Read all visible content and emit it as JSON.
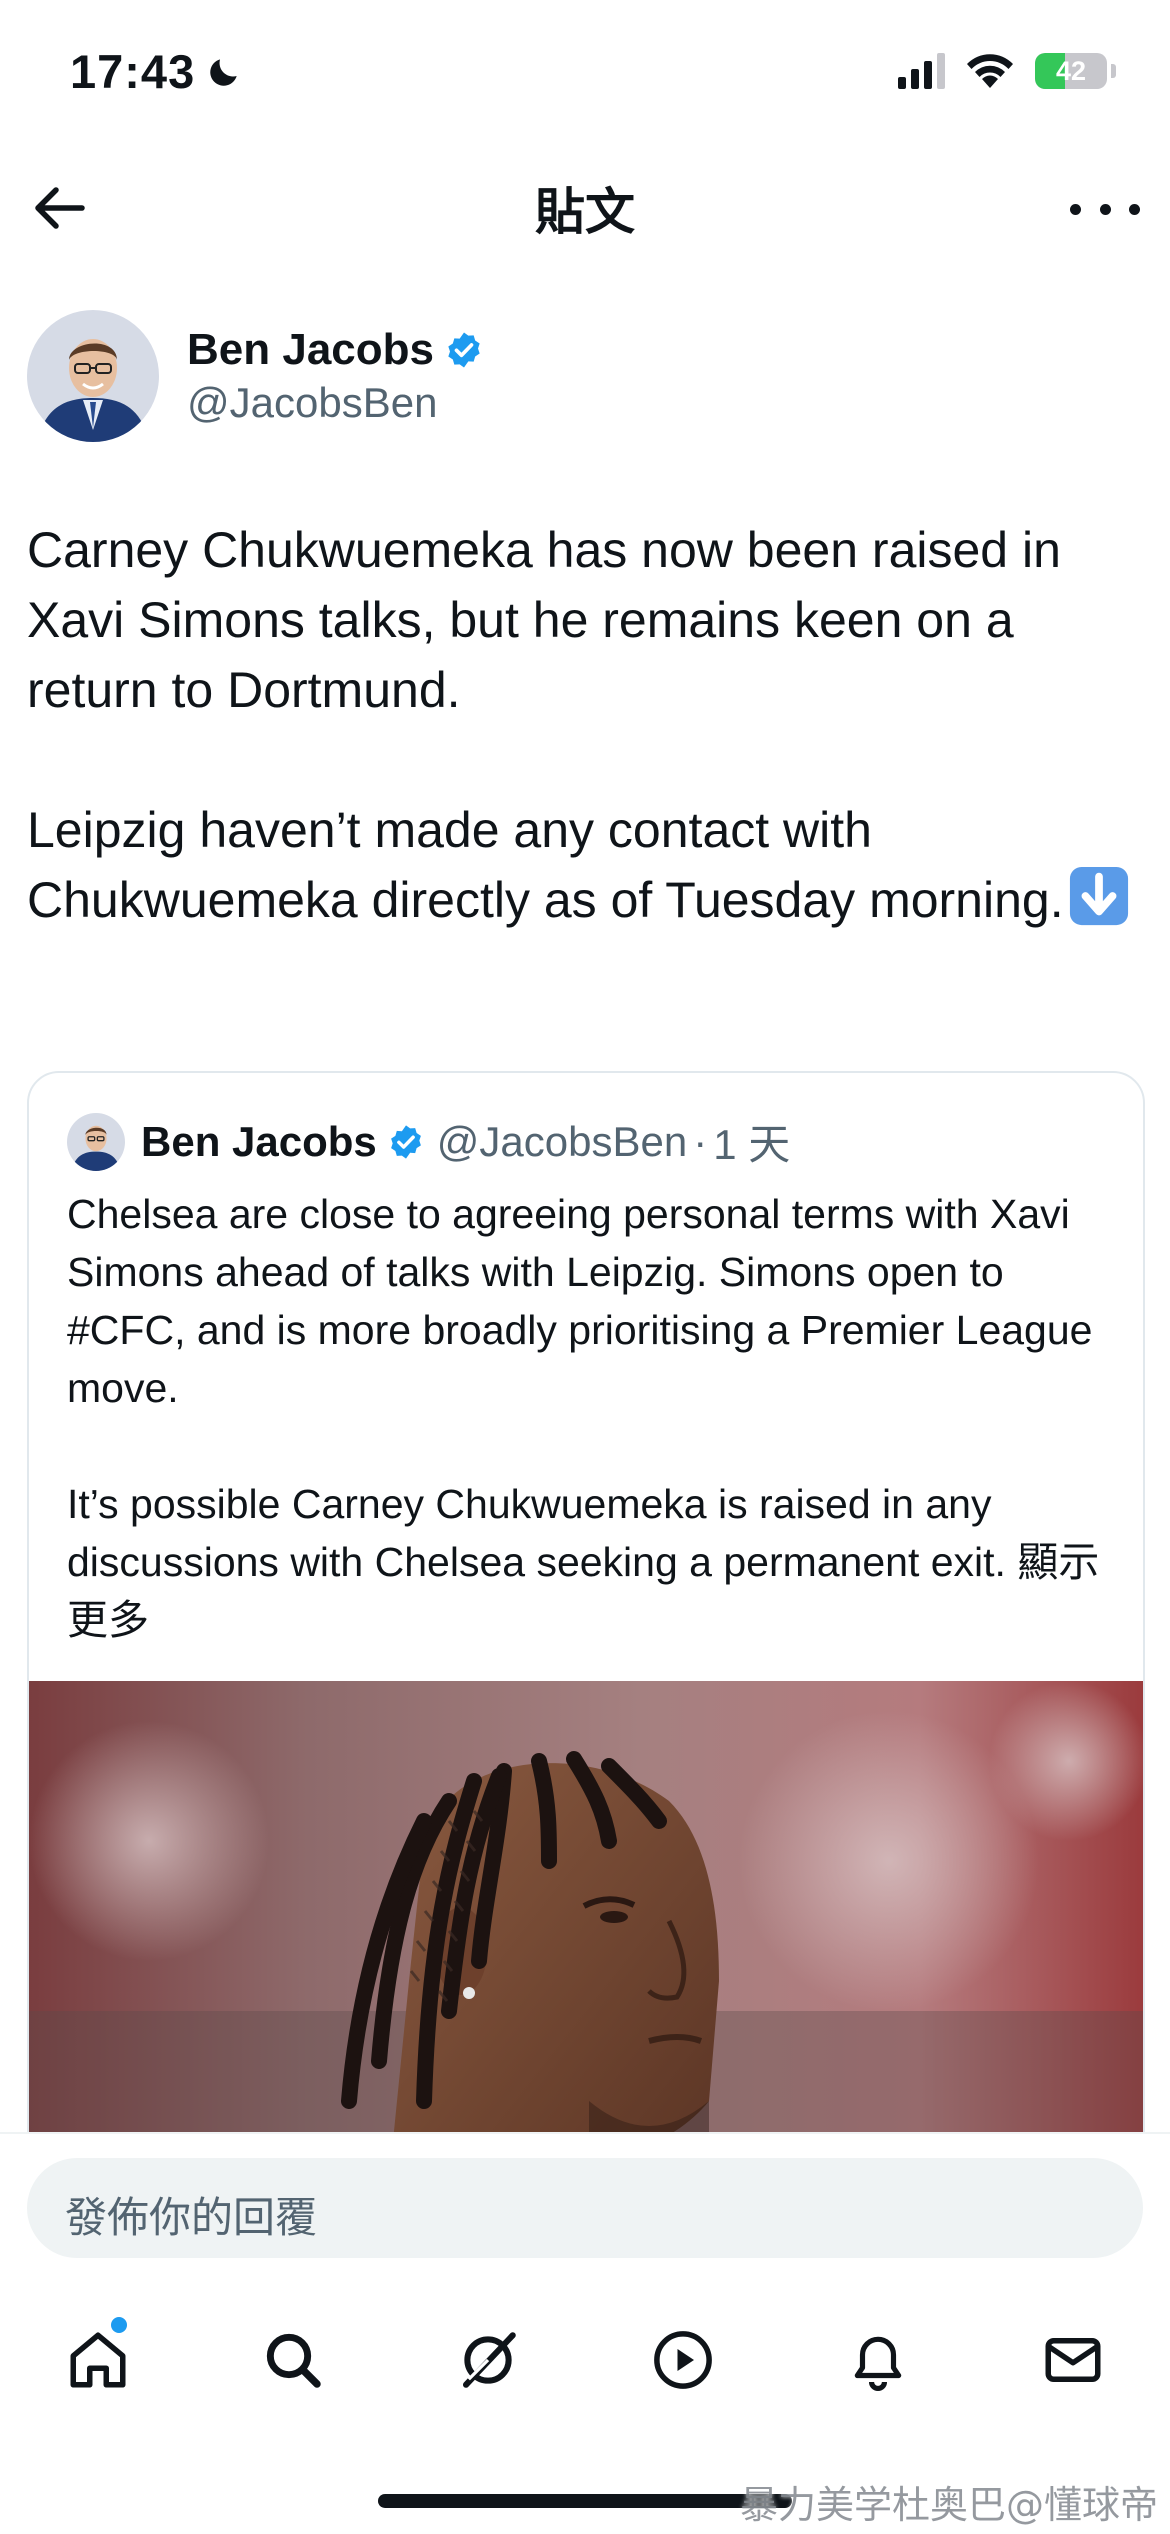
{
  "status_bar": {
    "time": "17:43",
    "battery": "42",
    "battery_level_percent": 42
  },
  "header": {
    "title": "貼文"
  },
  "post": {
    "author_name": "Ben Jacobs",
    "author_handle": "@JacobsBen",
    "text_paragraph_1": "Carney Chukwuemeka has now been raised in Xavi Simons talks, but he remains keen on a return to Dortmund.",
    "text_paragraph_2": "Leipzig haven’t made any contact with Chukwuemeka directly as of Tuesday morning.",
    "emoji": "arrow-down-emoji"
  },
  "quote": {
    "author_name": "Ben Jacobs",
    "author_handle": "@JacobsBen",
    "separator": "·",
    "time": "1 天",
    "text_paragraph_1": "Chelsea are close to agreeing personal terms with Xavi Simons ahead of talks with Leipzig. Simons open to #CFC, and is more broadly prioritising a Premier League move.",
    "text_paragraph_2": "It’s possible Carney Chukwuemeka is raised in any discussions with Chelsea seeking a permanent exit.",
    "show_more": "顯示更多"
  },
  "reply": {
    "placeholder": "發佈你的回覆"
  },
  "tabs": [
    {
      "icon": "home-icon",
      "has_notification_dot": true
    },
    {
      "icon": "search-icon"
    },
    {
      "icon": "grok-icon"
    },
    {
      "icon": "video-play-icon"
    },
    {
      "icon": "bell-icon"
    },
    {
      "icon": "mail-icon"
    }
  ],
  "watermark": "暴力美学杜奥巴@懂球帝",
  "colors": {
    "verified_blue": "#1d9bf0",
    "text_primary": "#0f1419",
    "text_secondary": "#536471",
    "battery_green": "#34c759"
  }
}
